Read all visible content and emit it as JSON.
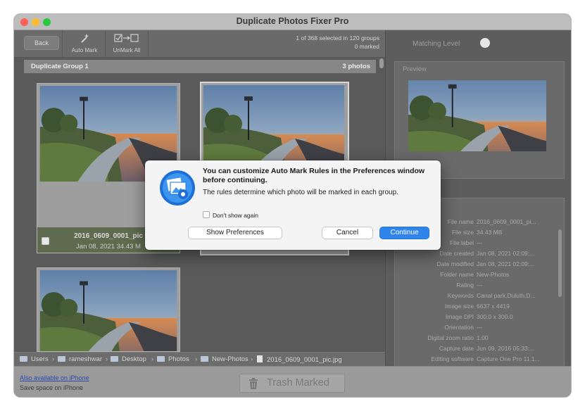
{
  "window": {
    "title": "Duplicate Photos Fixer Pro"
  },
  "toolbar": {
    "back_label": "Back",
    "auto_mark_label": "Auto Mark",
    "unmark_all_label": "UnMark All",
    "selection_info": "1 of 368 selected in 120 groups",
    "marked_info": "0 marked"
  },
  "group": {
    "title": "Duplicate Group 1",
    "count": "3 photos"
  },
  "thumbnails": [
    {
      "name": "2016_0609_0001_pic",
      "meta": "Jan 08, 2021  34.43 M"
    }
  ],
  "right_panel": {
    "matching_level_label": "Matching Level",
    "preview_label": "Preview",
    "info_rows": [
      {
        "key": "File name",
        "value": "2016_0609_0001_pi..."
      },
      {
        "key": "File size",
        "value": "34.43 MB"
      },
      {
        "key": "File label",
        "value": "---"
      },
      {
        "key": "Date created",
        "value": "Jan 08, 2021 02:09:..."
      },
      {
        "key": "Date modified",
        "value": "Jan 08, 2021 02:09:..."
      },
      {
        "key": "Folder name",
        "value": "New-Photos"
      },
      {
        "key": "Rating",
        "value": "---"
      },
      {
        "key": "Keywords",
        "value": "Canal park,Duluth,D..."
      },
      {
        "key": "Image size",
        "value": "6637 x 4419"
      },
      {
        "key": "Image DPI",
        "value": "300.0 x 300.0"
      },
      {
        "key": "Orientation",
        "value": "---"
      },
      {
        "key": "Digital zoom ratio",
        "value": "1.00"
      },
      {
        "key": "Capture date",
        "value": "Jun 09, 2016 05:33:..."
      },
      {
        "key": "Editing software",
        "value": "Capture One Pro 11.1..."
      },
      {
        "key": "Exposure",
        "value": "---"
      }
    ]
  },
  "path": [
    "Users",
    "rameshwar",
    "Desktop",
    "Photos",
    "New-Photos",
    "2016_0609_0001_pic.jpg"
  ],
  "bottom": {
    "iphone_link": "Also available on iPhone",
    "iphone_sub": "Save space on iPhone",
    "trash_label": "Trash Marked"
  },
  "dialog": {
    "title": "You can customize Auto Mark Rules in the Preferences window before continuing.",
    "text": "The rules determine which photo will be marked in each group.",
    "checkbox_label": "Don't show again",
    "show_prefs_label": "Show Preferences",
    "cancel_label": "Cancel",
    "continue_label": "Continue"
  },
  "colors": {
    "accent": "#2f84ec",
    "marked_footer": "#5f6b4f",
    "traffic_red": "#fe5f57",
    "traffic_yellow": "#febc2e",
    "traffic_green": "#28c840"
  }
}
